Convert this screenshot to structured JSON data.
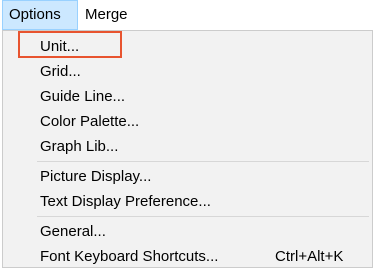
{
  "menubar": {
    "options_label": "Options",
    "merge_label": "Merge"
  },
  "menu": {
    "items": [
      {
        "label": "Unit..."
      },
      {
        "label": "Grid..."
      },
      {
        "label": "Guide Line..."
      },
      {
        "label": "Color Palette..."
      },
      {
        "label": "Graph Lib..."
      },
      {
        "label": "Picture Display..."
      },
      {
        "label": "Text Display Preference..."
      },
      {
        "label": "General..."
      },
      {
        "label": "Font Keyboard Shortcuts...",
        "shortcut": "Ctrl+Alt+K"
      }
    ]
  },
  "colors": {
    "highlight_box": "#e8542f",
    "menubar_selected": "#cce8ff",
    "menu_background": "#f2f2f2"
  }
}
